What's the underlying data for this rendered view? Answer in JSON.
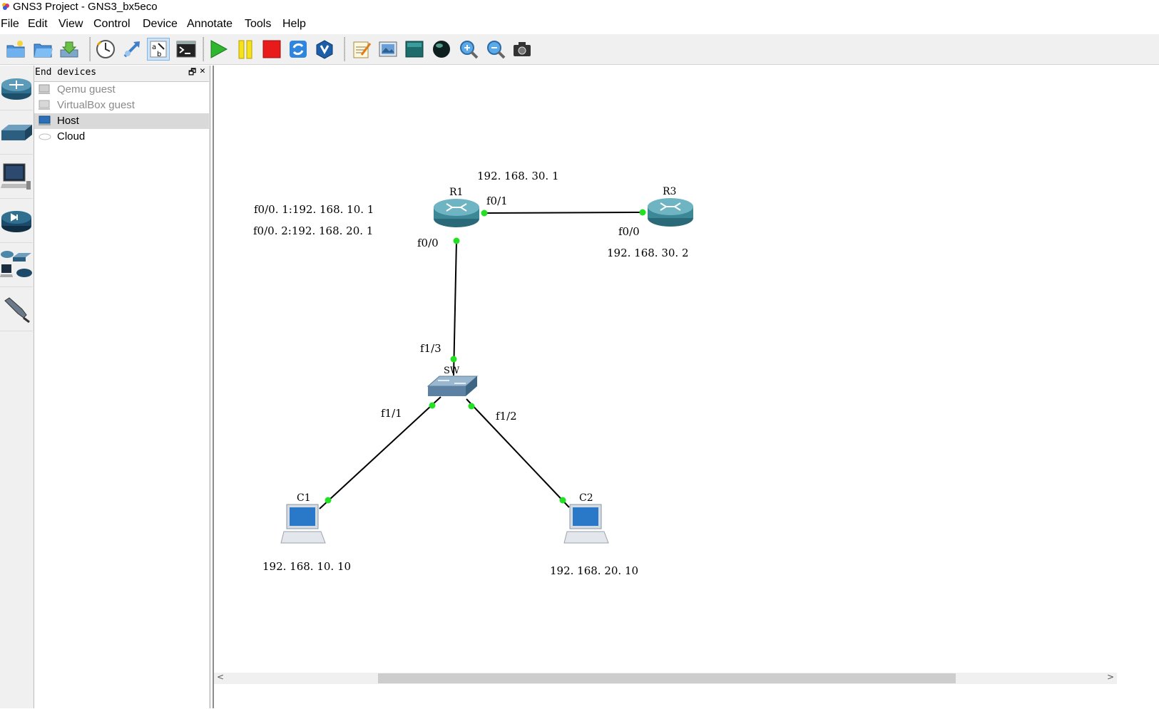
{
  "window": {
    "title": "GNS3 Project - GNS3_bx5eco"
  },
  "menu": [
    "File",
    "Edit",
    "View",
    "Control",
    "Device",
    "Annotate",
    "Tools",
    "Help"
  ],
  "toolbar": {
    "icons": [
      "new-project-icon",
      "open-project-icon",
      "save-project-icon",
      "snapshot-icon",
      "show-interface-labels-icon",
      "add-link-icon",
      "console-all-icon",
      "start-all-icon",
      "suspend-all-icon",
      "stop-all-icon",
      "reload-all-icon",
      "virtualbox-icon",
      "add-note-icon",
      "insert-picture-icon",
      "draw-rectangle-icon",
      "draw-ellipse-icon",
      "zoom-in-icon",
      "zoom-out-icon",
      "screenshot-icon"
    ]
  },
  "device_types": [
    "router-icon",
    "switch-icon",
    "end-device-icon",
    "security-device-icon",
    "all-devices-icon",
    "add-link-icon"
  ],
  "dock": {
    "title": "End devices",
    "items": [
      {
        "label": "Qemu guest",
        "icon": "qemu-icon",
        "enabled": false
      },
      {
        "label": "VirtualBox guest",
        "icon": "virtualbox-guest-icon",
        "enabled": false
      },
      {
        "label": "Host",
        "icon": "host-icon",
        "enabled": true,
        "selected": true
      },
      {
        "label": "Cloud",
        "icon": "cloud-icon",
        "enabled": true
      }
    ]
  },
  "topology": {
    "nodes": {
      "R1": "R1",
      "R3": "R3",
      "SW": "SW",
      "C1": "C1",
      "C2": "C2"
    },
    "interface_labels": {
      "r1_f01": "f0/1",
      "r1_f00": "f0/0",
      "r3_f00": "f0/0",
      "sw_f13": "f1/3",
      "sw_f11": "f1/1",
      "sw_f12": "f1/2"
    },
    "notes": {
      "r1_f01_ip": "192. 168. 30. 1",
      "r1_sub1": "f0/0. 1:192. 168. 10. 1",
      "r1_sub2": "f0/0. 2:192. 168. 20. 1",
      "r3_ip": "192. 168. 30. 2",
      "c1_ip": "192. 168. 10. 10",
      "c2_ip": "192. 168. 20. 10"
    },
    "link_color": "#000000",
    "port_up_color": "#22e022"
  }
}
